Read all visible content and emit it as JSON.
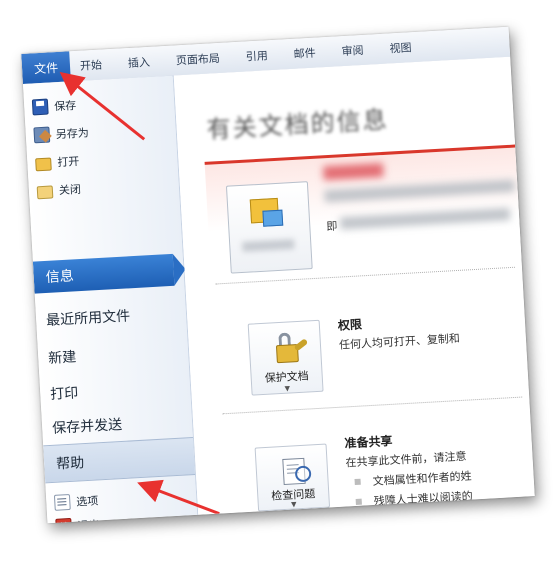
{
  "ribbon": {
    "file_tab": "文件",
    "tabs": [
      "开始",
      "插入",
      "页面布局",
      "引用",
      "邮件",
      "审阅",
      "视图"
    ]
  },
  "sidebar": {
    "commands": [
      {
        "label": "保存",
        "icon": "save-icon"
      },
      {
        "label": "另存为",
        "icon": "save-as-icon"
      },
      {
        "label": "打开",
        "icon": "open-folder-icon"
      },
      {
        "label": "关闭",
        "icon": "close-folder-icon"
      }
    ],
    "selected": "信息",
    "items": [
      "最近所用文件",
      "新建",
      "打印",
      "保存并发送"
    ],
    "help": "帮助",
    "options": "选项",
    "exit": "退出"
  },
  "main": {
    "title": "有关文档的信息",
    "doc_text_prefix": "即",
    "permissions": {
      "button_label": "保护文档",
      "title": "权限",
      "text": "任何人均可打开、复制和"
    },
    "prepare": {
      "button_label": "检查问题",
      "title": "准备共享",
      "text": "在共享此文件前，请注意",
      "bullets": [
        "文档属性和作者的姓",
        "残障人士难以阅读的"
      ]
    }
  },
  "colors": {
    "file_tab": "#1f5db3",
    "selected_item": "#2a6ec4",
    "doc_panel_border": "#d9372b",
    "annotation_arrow": "#e8312f"
  }
}
